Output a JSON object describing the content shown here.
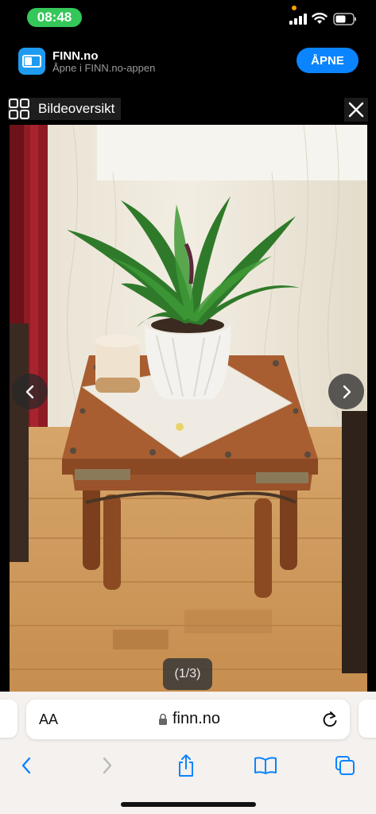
{
  "status_bar": {
    "time": "08:48",
    "signal_icon": "cellular-signal-icon",
    "wifi_icon": "wifi-icon",
    "battery_icon": "battery-icon"
  },
  "app_banner": {
    "title": "FINN.no",
    "subtitle": "Åpne i FINN.no-appen",
    "open_label": "ÅPNE",
    "app_icon": "finn-app-icon"
  },
  "viewer": {
    "grid_label": "Bildeoversikt",
    "counter": "(1/3)",
    "close_icon": "close-icon",
    "prev_icon": "chevron-left-icon",
    "next_icon": "chevron-right-icon"
  },
  "safari": {
    "text_size_label": "AA",
    "domain": "finn.no",
    "toolbar_icons": [
      "back-icon",
      "forward-icon",
      "share-icon",
      "bookmarks-icon",
      "tabs-icon"
    ]
  },
  "colors": {
    "accent": "#0a84ff",
    "time_pill": "#34c759",
    "safari_bg": "#f4f1ee"
  }
}
